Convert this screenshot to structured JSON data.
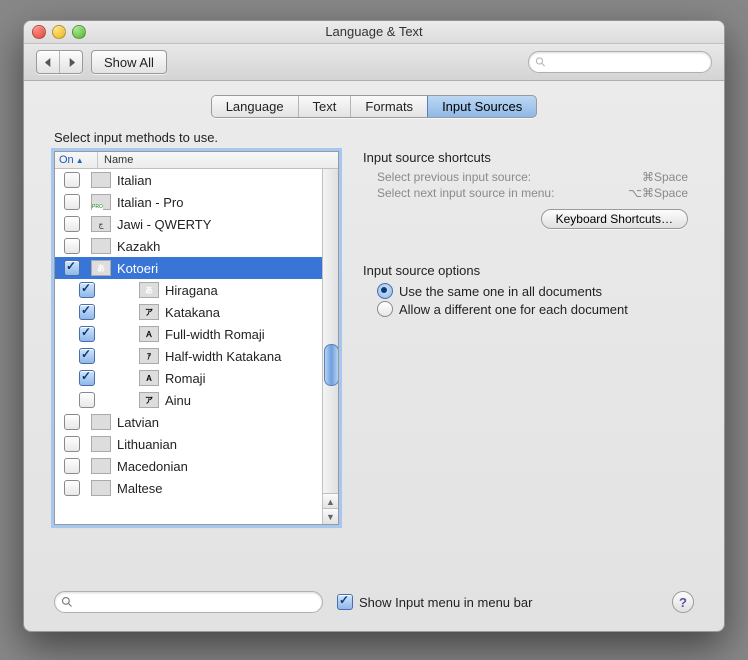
{
  "window": {
    "title": "Language & Text"
  },
  "toolbar": {
    "show_all": "Show All",
    "search_placeholder": ""
  },
  "tabs": [
    {
      "label": "Language",
      "active": false
    },
    {
      "label": "Text",
      "active": false
    },
    {
      "label": "Formats",
      "active": false
    },
    {
      "label": "Input Sources",
      "active": true
    }
  ],
  "instruction": "Select input methods to use.",
  "columns": {
    "on": "On",
    "name": "Name"
  },
  "items": [
    {
      "checked": false,
      "indent": 0,
      "flag_class": "flag-it",
      "label": "Italian"
    },
    {
      "checked": false,
      "indent": 0,
      "flag_class": "flag-it-pro",
      "label": "Italian - Pro"
    },
    {
      "checked": false,
      "indent": 0,
      "flag_class": "flag-jawi",
      "flag_text": "ج",
      "label": "Jawi - QWERTY"
    },
    {
      "checked": false,
      "indent": 0,
      "flag_class": "flag-kz",
      "label": "Kazakh"
    },
    {
      "checked": true,
      "indent": 0,
      "flag_class": "flag-jp",
      "flag_text": "あ",
      "label": "Kotoeri",
      "selected": true
    },
    {
      "checked": true,
      "indent": 1,
      "flag_class": "flag-jp",
      "flag_text": "あ",
      "label": "Hiragana"
    },
    {
      "checked": true,
      "indent": 1,
      "flag_class": "flag-jp-w",
      "flag_text": "ア",
      "label": "Katakana"
    },
    {
      "checked": true,
      "indent": 1,
      "flag_class": "flag-jp-w",
      "flag_text": "Ａ",
      "label": "Full-width Romaji"
    },
    {
      "checked": true,
      "indent": 1,
      "flag_class": "flag-jp-w",
      "flag_text": "ｱ",
      "label": "Half-width Katakana"
    },
    {
      "checked": true,
      "indent": 1,
      "flag_class": "flag-jp-w",
      "flag_text": "A",
      "label": "Romaji"
    },
    {
      "checked": false,
      "indent": 1,
      "flag_class": "flag-jp-w",
      "flag_text": "ア",
      "label": "Ainu"
    },
    {
      "checked": false,
      "indent": 0,
      "flag_class": "flag-lv",
      "label": "Latvian"
    },
    {
      "checked": false,
      "indent": 0,
      "flag_class": "flag-lt",
      "label": "Lithuanian"
    },
    {
      "checked": false,
      "indent": 0,
      "flag_class": "flag-mk",
      "label": "Macedonian"
    },
    {
      "checked": false,
      "indent": 0,
      "flag_class": "flag-mt",
      "label": "Maltese"
    }
  ],
  "shortcuts": {
    "title": "Input source shortcuts",
    "rows": [
      {
        "label": "Select previous input source:",
        "key": "⌘Space"
      },
      {
        "label": "Select next input source in menu:",
        "key": "⌥⌘Space"
      }
    ],
    "button": "Keyboard Shortcuts…"
  },
  "options": {
    "title": "Input source options",
    "radios": [
      {
        "label": "Use the same one in all documents",
        "selected": true
      },
      {
        "label": "Allow a different one for each document",
        "selected": false
      }
    ]
  },
  "footer": {
    "show_menu_label": "Show Input menu in menu bar",
    "show_menu_checked": true
  }
}
